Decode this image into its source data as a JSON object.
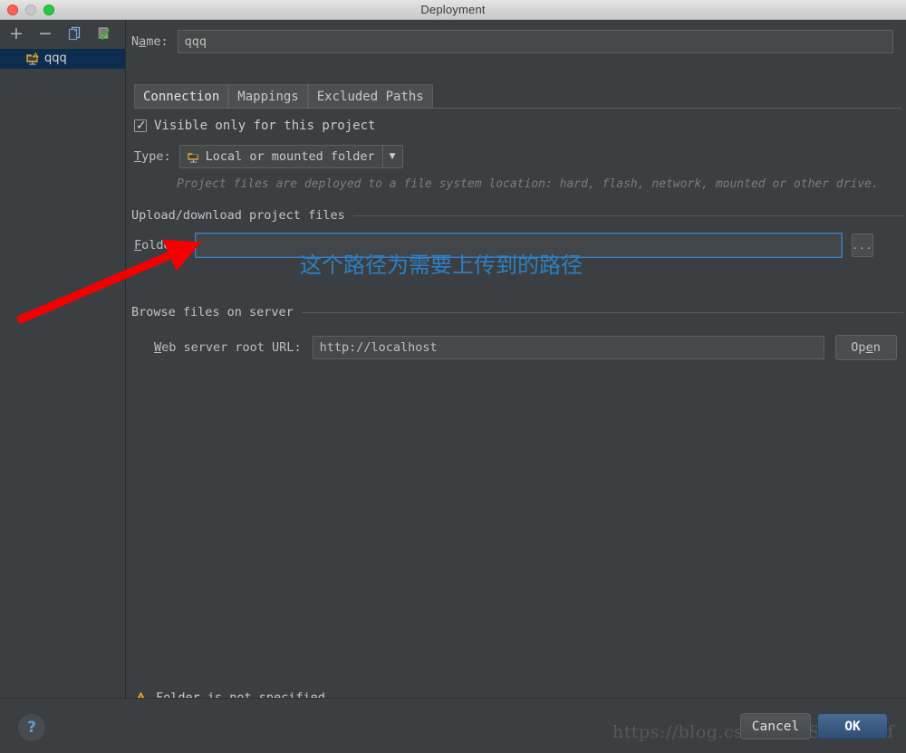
{
  "window": {
    "title": "Deployment",
    "traffic_lights": [
      "close",
      "minimize",
      "maximize"
    ]
  },
  "sidebar": {
    "toolbar": [
      {
        "name": "add",
        "glyph": "+"
      },
      {
        "name": "remove",
        "glyph": "−"
      },
      {
        "name": "copy",
        "glyph": "copy-icon"
      },
      {
        "name": "set-default",
        "glyph": "check-list-icon"
      }
    ],
    "items": [
      {
        "label": "qqq",
        "icon": "folder-warning-icon",
        "selected": true
      }
    ]
  },
  "main": {
    "name_label": "Name:",
    "name_value": "qqq",
    "tabs": [
      {
        "label": "Connection",
        "active": true
      },
      {
        "label": "Mappings",
        "active": false
      },
      {
        "label": "Excluded Paths",
        "active": false
      }
    ],
    "visible_only_checkbox": {
      "label": "Visible only for this project",
      "checked": true
    },
    "type_label": "Type:",
    "type_value": "Local or mounted folder",
    "type_hint": "Project files are deployed to a file system location:  hard, flash, network, mounted or other drive.",
    "upload_section_title": "Upload/download project files",
    "folder_label": "Folder:",
    "folder_value": "",
    "folder_browse_label": "...",
    "browse_section_title": "Browse files on server",
    "url_label": "Web server root URL:",
    "url_value": "http://localhost",
    "open_label": "Open",
    "warning_text": "Folder is not specified"
  },
  "footer": {
    "help_label": "?",
    "cancel_label": "Cancel",
    "ok_label": "OK",
    "watermark": "https://blog.csdn.net/Smallcaff"
  },
  "annotation": {
    "text": "这个路径为需要上传到的路径",
    "text_color": "#2a80c4",
    "arrow_color": "#f40000"
  }
}
